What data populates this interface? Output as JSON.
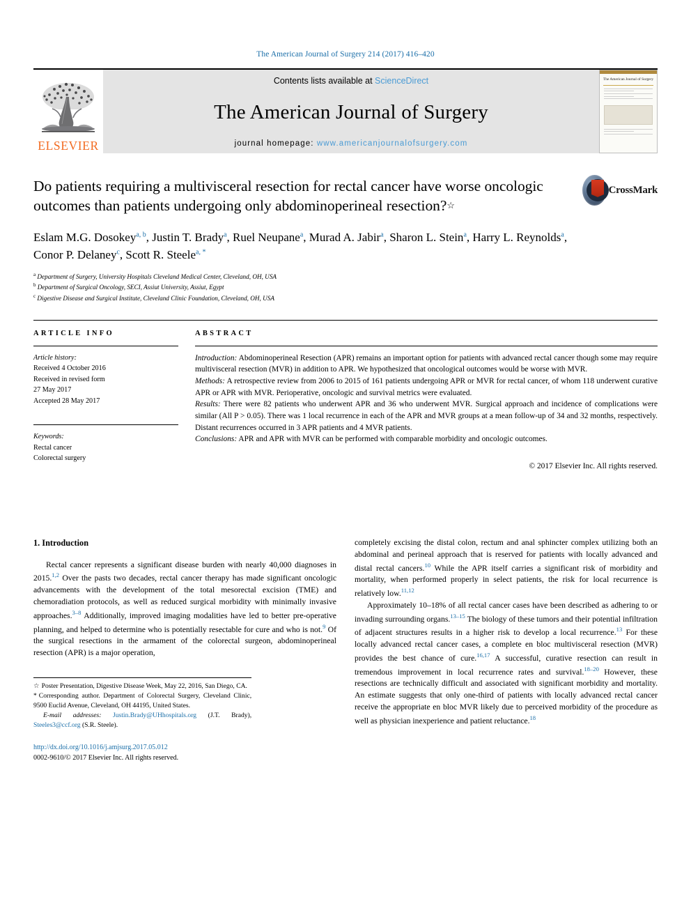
{
  "running_head": "The American Journal of Surgery 214 (2017) 416–420",
  "masthead": {
    "contents_prefix": "Contents lists available at ",
    "sciencedirect": "ScienceDirect",
    "journal_name": "The American Journal of Surgery",
    "homepage_prefix": "journal homepage: ",
    "homepage_url": "www.americanjournalofsurgery.com",
    "publisher": "ELSEVIER",
    "cover_title": "The American Journal of Surgery"
  },
  "crossmark": {
    "label": "CrossMark"
  },
  "title": {
    "text": "Do patients requiring a multivisceral resection for rectal cancer have worse oncologic outcomes than patients undergoing only abdominoperineal resection?",
    "marker": "☆"
  },
  "authors": [
    {
      "name": "Eslam M.G. Dosokey",
      "marks": "a, b"
    },
    {
      "name": "Justin T. Brady",
      "marks": "a"
    },
    {
      "name": "Ruel Neupane",
      "marks": "a"
    },
    {
      "name": "Murad A. Jabir",
      "marks": "a"
    },
    {
      "name": "Sharon L. Stein",
      "marks": "a"
    },
    {
      "name": "Harry L. Reynolds",
      "marks": "a"
    },
    {
      "name": "Conor P. Delaney",
      "marks": "c"
    },
    {
      "name": "Scott R. Steele",
      "marks": "a, *"
    }
  ],
  "affiliations": [
    {
      "mark": "a",
      "text": "Department of Surgery, University Hospitals Cleveland Medical Center, Cleveland, OH, USA"
    },
    {
      "mark": "b",
      "text": "Department of Surgical Oncology, SECI, Assiut University, Assiut, Egypt"
    },
    {
      "mark": "c",
      "text": "Digestive Disease and Surgical Institute, Cleveland Clinic Foundation, Cleveland, OH, USA"
    }
  ],
  "article_info": {
    "heading": "ARTICLE INFO",
    "history_label": "Article history:",
    "history_lines": [
      "Received 4 October 2016",
      "Received in revised form",
      "27 May 2017",
      "Accepted 28 May 2017"
    ],
    "keywords_label": "Keywords:",
    "keywords": [
      "Rectal cancer",
      "Colorectal surgery"
    ]
  },
  "abstract": {
    "heading": "ABSTRACT",
    "sections": [
      {
        "lead": "Introduction:",
        "text": " Abdominoperineal Resection (APR) remains an important option for patients with advanced rectal cancer though some may require multivisceral resection (MVR) in addition to APR. We hypothesized that oncological outcomes would be worse with MVR."
      },
      {
        "lead": "Methods:",
        "text": " A retrospective review from 2006 to 2015 of 161 patients undergoing APR or MVR for rectal cancer, of whom 118 underwent curative APR or APR with MVR. Perioperative, oncologic and survival metrics were evaluated."
      },
      {
        "lead": "Results:",
        "text": " There were 82 patients who underwent APR and 36 who underwent MVR. Surgical approach and incidence of complications were similar (All P > 0.05). There was 1 local recurrence in each of the APR and MVR groups at a mean follow-up of 34 and 32 months, respectively. Distant recurrences occurred in 3 APR patients and 4 MVR patients."
      },
      {
        "lead": "Conclusions:",
        "text": " APR and APR with MVR can be performed with comparable morbidity and oncologic outcomes."
      }
    ],
    "copyright": "© 2017 Elsevier Inc. All rights reserved."
  },
  "body": {
    "section_heading": "1. Introduction",
    "left_paragraphs": [
      "Rectal cancer represents a significant disease burden with nearly 40,000 diagnoses in 2015.",
      "Over the pasts two decades, rectal cancer therapy has made significant oncologic advancements with the development of the total mesorectal excision (TME) and chemoradiation protocols, as well as reduced surgical morbidity with minimally invasive approaches.",
      "Additionally, improved imaging modalities have led to better pre-operative planning, and helped to determine who is potentially resectable for cure and who is not.",
      "Of the surgical resections in the armament of the colorectal surgeon, abdominoperineal resection (APR) is a major operation,"
    ],
    "left_refs": [
      "1,2",
      "3–8",
      "9"
    ],
    "right_p1_a": "completely excising the distal colon, rectum and anal sphincter complex utilizing both an abdominal and perineal approach that is reserved for patients with locally advanced and distal rectal cancers.",
    "right_p1_ref1": "10",
    "right_p1_b": " While the APR itself carries a significant risk of morbidity and mortality, when performed properly in select patients, the risk for local recurrence is relatively low.",
    "right_p1_ref2": "11,12",
    "right_p2_a": "Approximately 10–18% of all rectal cancer cases have been described as adhering to or invading surrounding organs.",
    "right_p2_ref1": "13–15",
    "right_p2_b": " The biology of these tumors and their potential infiltration of adjacent structures results in a higher risk to develop a local recurrence.",
    "right_p2_ref2": "13",
    "right_p2_c": " For these locally advanced rectal cancer cases, a complete en bloc multivisceral resection (MVR) provides the best chance of cure.",
    "right_p2_ref3": "16,17",
    "right_p2_d": " A successful, curative resection can result in tremendous improvement in local recurrence rates and survival.",
    "right_p2_ref4": "18–20",
    "right_p2_e": " However, these resections are technically difficult and associated with significant morbidity and mortality. An estimate suggests that only one-third of patients with locally advanced rectal cancer receive the appropriate en bloc MVR likely due to perceived morbidity of the procedure as well as physician inexperience and patient reluctance.",
    "right_p2_ref5": "18"
  },
  "footnotes": {
    "poster_mark": "☆",
    "poster_text": "Poster Presentation, Digestive Disease Week, May 22, 2016, San Diego, CA.",
    "corresponding_mark": "*",
    "corresponding_text": "Corresponding author. Department of Colorectal Surgery, Cleveland Clinic, 9500 Euclid Avenue, Cleveland, OH 44195, United States.",
    "email_label": "E-mail addresses:",
    "email_1": "Justin.Brady@UHhospitals.org",
    "email_1_owner": "(J.T. Brady)",
    "email_2": "Steeles3@ccf.org",
    "email_2_owner": "(S.R. Steele).",
    "doi": "http://dx.doi.org/10.1016/j.amjsurg.2017.05.012",
    "issn_line": "0002-9610/© 2017 Elsevier Inc. All rights reserved."
  },
  "colors": {
    "link_blue": "#1a6ea8",
    "sciencedirect_blue": "#4a9bd4",
    "elsevier_orange": "#F26B21",
    "masthead_grey": "#e4e4e4"
  }
}
